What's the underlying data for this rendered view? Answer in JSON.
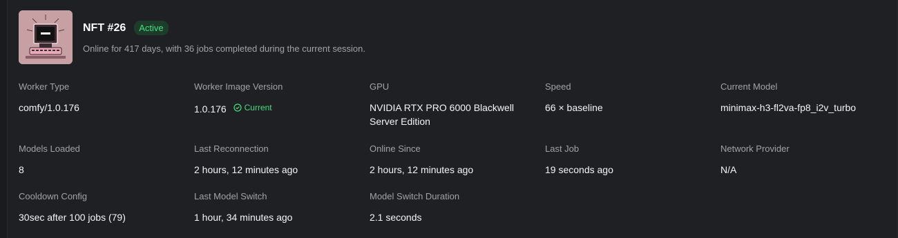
{
  "worker": {
    "name": "NFT #26",
    "status": "Active",
    "summary": "Online for 417 days, with 36 jobs completed during the current session."
  },
  "fields": {
    "worker_type": {
      "label": "Worker Type",
      "value": "comfy/1.0.176"
    },
    "image_version": {
      "label": "Worker Image Version",
      "value": "1.0.176",
      "tag": "Current"
    },
    "gpu": {
      "label": "GPU",
      "value": "NVIDIA RTX PRO 6000 Blackwell Server Edition"
    },
    "speed": {
      "label": "Speed",
      "value": "66 × baseline"
    },
    "current_model": {
      "label": "Current Model",
      "value": "minimax-h3-fl2va-fp8_i2v_turbo"
    },
    "models_loaded": {
      "label": "Models Loaded",
      "value": "8"
    },
    "last_reconnection": {
      "label": "Last Reconnection",
      "value": "2 hours, 12 minutes ago"
    },
    "online_since": {
      "label": "Online Since",
      "value": "2 hours, 12 minutes ago"
    },
    "last_job": {
      "label": "Last Job",
      "value": "19 seconds ago"
    },
    "network_provider": {
      "label": "Network Provider",
      "value": "N/A"
    },
    "cooldown_config": {
      "label": "Cooldown Config",
      "value": "30sec after 100 jobs (79)"
    },
    "last_model_switch": {
      "label": "Last Model Switch",
      "value": "1 hour, 34 minutes ago"
    },
    "model_switch_duration": {
      "label": "Model Switch Duration",
      "value": "2.1 seconds"
    }
  },
  "colors": {
    "background": "#1f2023",
    "accent_green": "#4ade80",
    "muted_text": "#a0a3a9"
  },
  "icons": {
    "thumbnail": "retro-computer-image",
    "current_tag": "check-circle-icon"
  }
}
